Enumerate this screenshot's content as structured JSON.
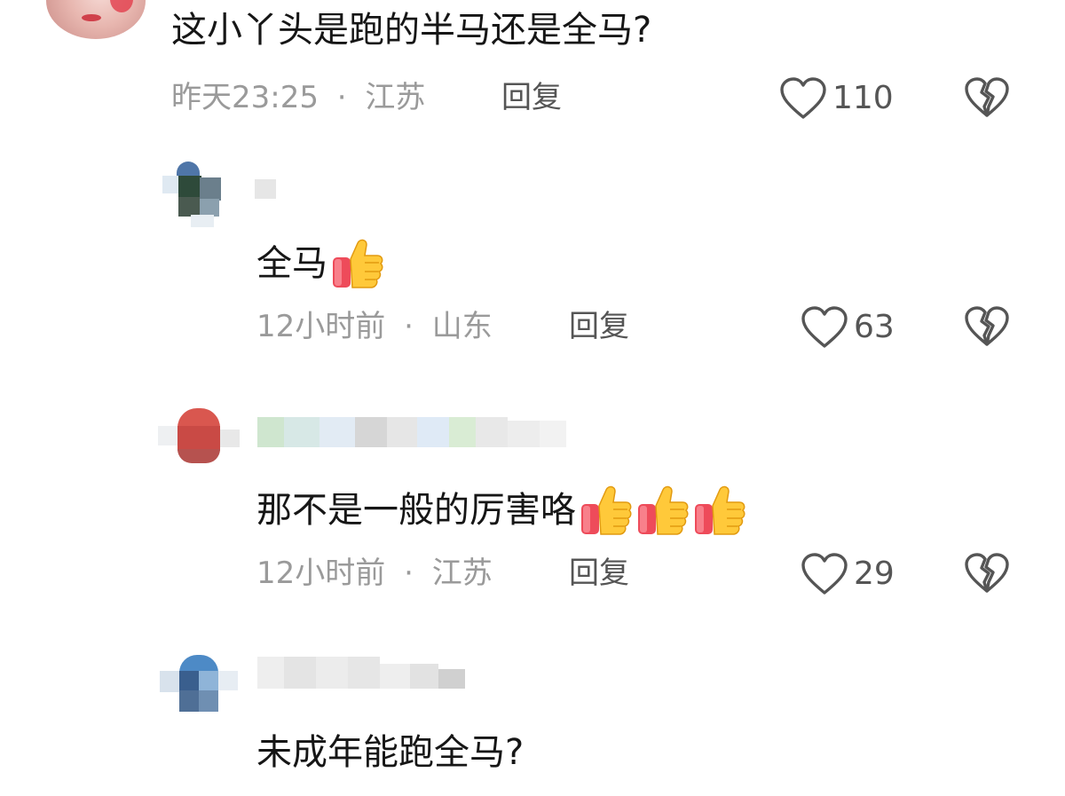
{
  "comments": [
    {
      "text": "这小丫头是跑的半马还是全马?",
      "time": "昨天23:25",
      "location": "江苏",
      "reply_label": "回复",
      "likes": "110"
    },
    {
      "text": "全马",
      "emoji_count": 1,
      "time": "12小时前",
      "location": "山东",
      "reply_label": "回复",
      "likes": "63"
    },
    {
      "text": "那不是一般的厉害咯",
      "emoji_count": 3,
      "time": "12小时前",
      "location": "江苏",
      "reply_label": "回复",
      "likes": "29"
    },
    {
      "text": "未成年能跑全马?"
    }
  ],
  "separator": "·",
  "icons": {
    "like": "heart-outline-icon",
    "dislike": "broken-heart-icon",
    "emoji": "thumbs-up-emoji"
  },
  "colors": {
    "text": "#161616",
    "meta": "#9a9a9a",
    "icon": "#555555"
  }
}
